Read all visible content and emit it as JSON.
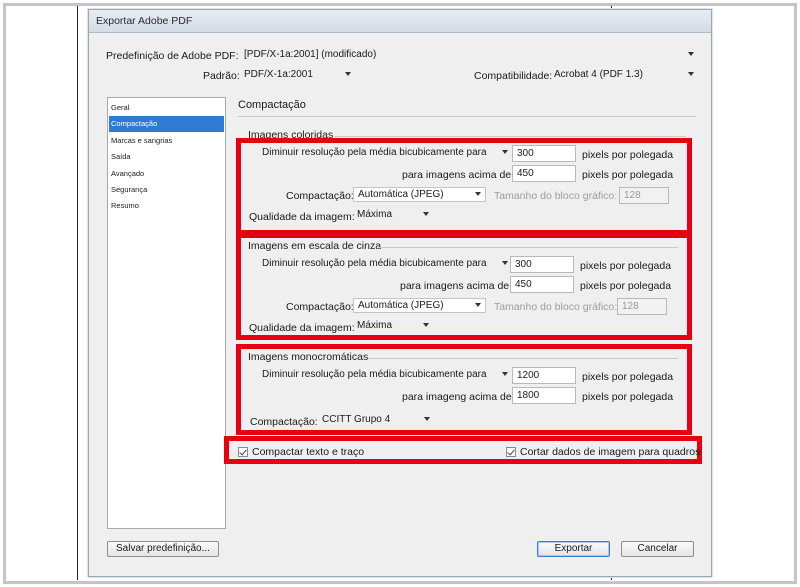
{
  "window": {
    "title": "Exportar Adobe PDF"
  },
  "header": {
    "preset_label": "Predefinição de Adobe PDF:",
    "preset_value": "[PDF/X-1a:2001] (modificado)",
    "standard_label": "Padrão:",
    "standard_value": "PDF/X-1a:2001",
    "compat_label": "Compatibilidade:",
    "compat_value": "Acrobat 4 (PDF 1.3)"
  },
  "sidebar": {
    "items": [
      {
        "label": "Geral"
      },
      {
        "label": "Compactação"
      },
      {
        "label": "Marcas e sangrias"
      },
      {
        "label": "Saída"
      },
      {
        "label": "Avançado"
      },
      {
        "label": "Segurança"
      },
      {
        "label": "Resumo"
      }
    ],
    "active_index": 1
  },
  "panel": {
    "title": "Compactação",
    "color": {
      "title": "Imagens coloridas",
      "resample_method": "Diminuir resolução pela média bicubicamente para",
      "resample_value": "300",
      "ppi_label_1": "pixels por polegada",
      "above_label": "para imagens acima de:",
      "above_value": "450",
      "ppi_label_2": "pixels por polegada",
      "compression_label": "Compactação:",
      "compression_value": "Automática (JPEG)",
      "tile_label": "Tamanho do bloco gráfico:",
      "tile_value": "128",
      "quality_label": "Qualidade da imagem:",
      "quality_value": "Máxima"
    },
    "gray": {
      "title": "Imagens em escala de cinza",
      "resample_method": "Diminuir resolução pela média bicubicamente para",
      "resample_value": "300",
      "ppi_label_1": "pixels por polegada",
      "above_label": "para imagens acima de:",
      "above_value": "450",
      "ppi_label_2": "pixels por polegada",
      "compression_label": "Compactação:",
      "compression_value": "Automática (JPEG)",
      "tile_label": "Tamanho do bloco gráfico:",
      "tile_value": "128",
      "quality_label": "Qualidade da imagem:",
      "quality_value": "Máxima"
    },
    "mono": {
      "title": "Imagens monocromáticas",
      "resample_method": "Diminuir resolução pela média bicubicamente para",
      "resample_value": "1200",
      "ppi_label_1": "pixels por polegada",
      "above_label": "para imageng acima de:",
      "above_value": "1800",
      "ppi_label_2": "pixels por polegada",
      "compression_label": "Compactação:",
      "compression_value": "CCITT Grupo 4"
    },
    "compress_text_label": "Compactar texto e traço",
    "crop_label": "Cortar dados de imagem para quadros"
  },
  "footer": {
    "save_preset": "Salvar predefinição...",
    "export": "Exportar",
    "cancel": "Cancelar"
  },
  "colors": {
    "highlight_box": "#e60012",
    "selection": "#2f7bd4"
  }
}
